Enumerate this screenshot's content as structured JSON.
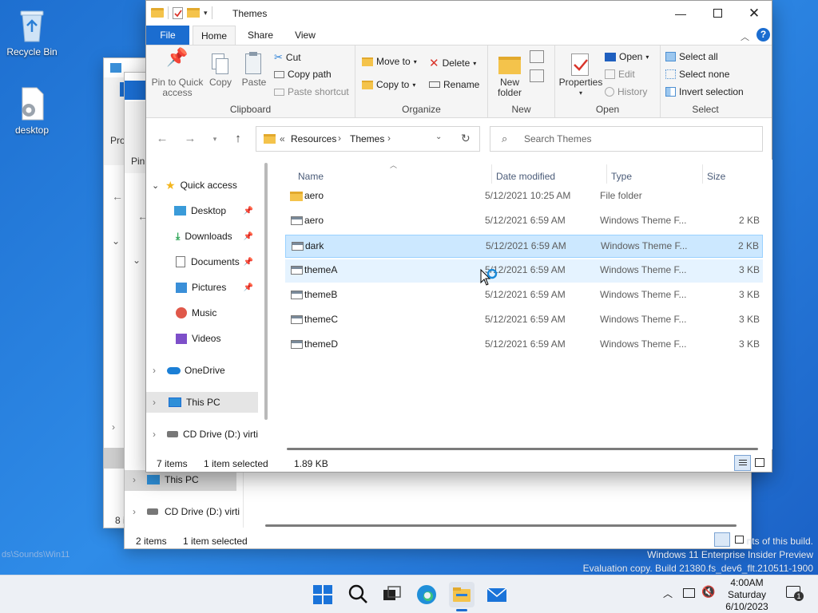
{
  "desktop": {
    "icons": [
      {
        "label": "Recycle Bin"
      },
      {
        "label": "desktop"
      }
    ],
    "watermark": {
      "line1": "nts of this build.",
      "line2": "Windows 11 Enterprise Insider Preview",
      "line3": "Evaluation copy. Build 21380.fs_dev6_flt.210511-1900",
      "left_faint": "ds\\Sounds\\Win11"
    }
  },
  "background_window": {
    "status": {
      "items": "2 items",
      "selected": "1 item selected"
    },
    "nav": {
      "this_pc": "This PC",
      "cd_drive": "CD Drive (D:) virti"
    },
    "partial": {
      "pin": "Pin",
      "pro": "Pro",
      "count": "8 i"
    }
  },
  "window": {
    "title": "Themes",
    "tabs": {
      "file": "File",
      "home": "Home",
      "share": "Share",
      "view": "View"
    },
    "ribbon": {
      "clipboard": {
        "label": "Clipboard",
        "pin": "Pin to Quick access",
        "copy": "Copy",
        "paste": "Paste",
        "cut": "Cut",
        "copy_path": "Copy path",
        "paste_shortcut": "Paste shortcut"
      },
      "organize": {
        "label": "Organize",
        "move_to": "Move to",
        "copy_to": "Copy to",
        "delete": "Delete",
        "rename": "Rename"
      },
      "new": {
        "label": "New",
        "new_folder": "New folder"
      },
      "open": {
        "label": "Open",
        "properties": "Properties",
        "open": "Open",
        "edit": "Edit",
        "history": "History"
      },
      "select": {
        "label": "Select",
        "select_all": "Select all",
        "select_none": "Select none",
        "invert": "Invert selection"
      }
    },
    "address": {
      "prefix": "«",
      "crumbs": [
        "Resources",
        "Themes"
      ]
    },
    "search": {
      "placeholder": "Search Themes"
    },
    "nav_pane": {
      "quick_access": "Quick access",
      "items": [
        "Desktop",
        "Downloads",
        "Documents",
        "Pictures",
        "Music",
        "Videos"
      ],
      "onedrive": "OneDrive",
      "this_pc": "This PC",
      "cd_drive": "CD Drive (D:) virti"
    },
    "columns": {
      "name": "Name",
      "date": "Date modified",
      "type": "Type",
      "size": "Size"
    },
    "files": [
      {
        "name": "aero",
        "date": "5/12/2021 10:25 AM",
        "type": "File folder",
        "size": "",
        "kind": "folder"
      },
      {
        "name": "aero",
        "date": "5/12/2021 6:59 AM",
        "type": "Windows Theme F...",
        "size": "2 KB",
        "kind": "theme"
      },
      {
        "name": "dark",
        "date": "5/12/2021 6:59 AM",
        "type": "Windows Theme F...",
        "size": "2 KB",
        "kind": "theme",
        "selected": true
      },
      {
        "name": "themeA",
        "date": "5/12/2021 6:59 AM",
        "type": "Windows Theme F...",
        "size": "3 KB",
        "kind": "theme",
        "hover": true
      },
      {
        "name": "themeB",
        "date": "5/12/2021 6:59 AM",
        "type": "Windows Theme F...",
        "size": "3 KB",
        "kind": "theme"
      },
      {
        "name": "themeC",
        "date": "5/12/2021 6:59 AM",
        "type": "Windows Theme F...",
        "size": "3 KB",
        "kind": "theme"
      },
      {
        "name": "themeD",
        "date": "5/12/2021 6:59 AM",
        "type": "Windows Theme F...",
        "size": "3 KB",
        "kind": "theme"
      }
    ],
    "status": {
      "items": "7 items",
      "selected": "1 item selected",
      "size": "1.89 KB"
    }
  },
  "taskbar": {
    "time": "4:00AM",
    "day": "Saturday",
    "date": "6/10/2023",
    "notification_count": "1"
  },
  "colors": {
    "accent": "#1b6dd0",
    "selection": "#cce8ff",
    "hover": "#e5f3ff",
    "folder": "#f4c34b"
  }
}
